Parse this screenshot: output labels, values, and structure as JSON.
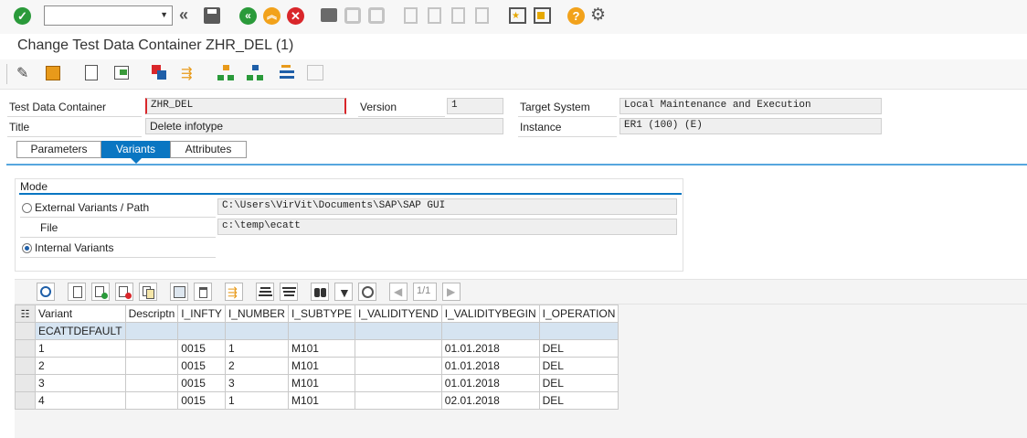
{
  "toolbar": {
    "command_field_value": "",
    "icons": [
      "enter-icon",
      "command-field",
      "back-double-icon",
      "save-icon",
      "back-icon",
      "exit-icon",
      "cancel-icon",
      "print-icon",
      "find-icon",
      "find-next-icon",
      "first-page-icon",
      "previous-page-icon",
      "next-page-icon",
      "last-page-icon",
      "new-session-icon",
      "shortcut-icon",
      "help-icon",
      "customize-layout-icon"
    ]
  },
  "page": {
    "title": "Change Test Data Container ZHR_DEL (1)"
  },
  "app_toolbar": {
    "icons": [
      "display-change-icon",
      "other-object-icon",
      "check-icon",
      "where-used-icon",
      "parameters-icon",
      "export-icon",
      "structure-icon",
      "hierarchy-icon",
      "list-icon"
    ]
  },
  "header": {
    "tdc_label": "Test Data Container",
    "tdc_value": "ZHR_DEL",
    "version_label": "Version",
    "version_value": "1",
    "target_label": "Target System",
    "target_value": "Local Maintenance and Execution",
    "title_label": "Title",
    "title_value": "Delete infotype",
    "instance_label": "Instance",
    "instance_value": "ER1 (100) (E)"
  },
  "tabs": [
    {
      "label": "Parameters",
      "active": false
    },
    {
      "label": "Variants",
      "active": true
    },
    {
      "label": "Attributes",
      "active": false
    }
  ],
  "mode": {
    "title": "Mode",
    "external_label": "External Variants / Path",
    "external_value": "C:\\Users\\VirVit\\Documents\\SAP\\SAP GUI",
    "file_label": "File",
    "file_value": "c:\\temp\\ecatt",
    "internal_label": "Internal Variants",
    "selected": "internal"
  },
  "alv_toolbar": {
    "page_indicator": "1/1",
    "icons": [
      "refresh-icon",
      "new-row-icon",
      "insert-row-icon",
      "delete-row-icon",
      "copy-row-icon",
      "select-all-icon",
      "delete-icon",
      "append-icon",
      "sort-ascending-icon",
      "sort-descending-icon",
      "find-icon",
      "filter-icon",
      "total-icon",
      "previous-icon",
      "next-icon"
    ]
  },
  "grid": {
    "columns": [
      "Variant",
      "Descriptn",
      "I_INFTY",
      "I_NUMBER",
      "I_SUBTYPE",
      "I_VALIDITYEND",
      "I_VALIDITYBEGIN",
      "I_OPERATION"
    ],
    "default_row": [
      "ECATTDEFAULT",
      "",
      "",
      "",
      "",
      "",
      "",
      ""
    ],
    "rows": [
      [
        "1",
        "",
        "0015",
        "1",
        "M101",
        "",
        "01.01.2018",
        "DEL"
      ],
      [
        "2",
        "",
        "0015",
        "2",
        "M101",
        "",
        "01.01.2018",
        "DEL"
      ],
      [
        "3",
        "",
        "0015",
        "3",
        "M101",
        "",
        "01.01.2018",
        "DEL"
      ],
      [
        "4",
        "",
        "0015",
        "1",
        "M101",
        "",
        "02.01.2018",
        "DEL"
      ]
    ]
  },
  "colors": {
    "accent": "#0a76c2",
    "green": "#2a9a3a",
    "orange": "#f2a21b",
    "red": "#d9262a"
  }
}
